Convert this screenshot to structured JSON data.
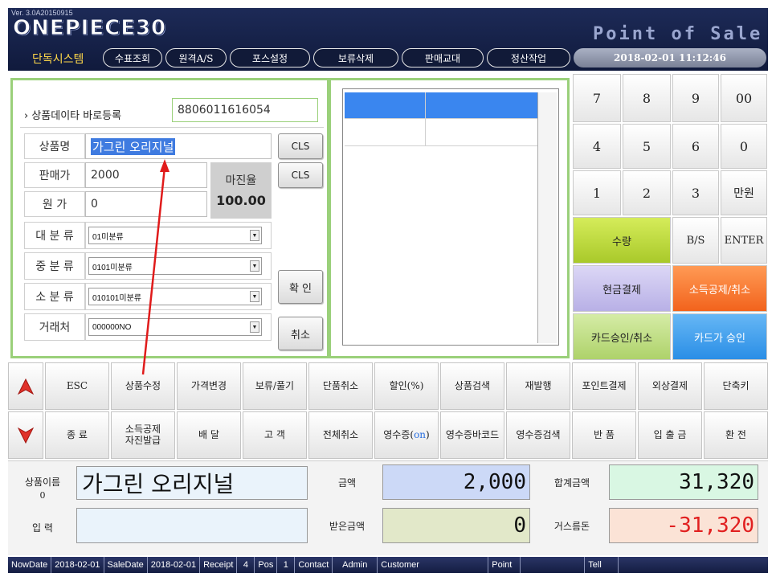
{
  "header": {
    "version": "Ver. 3.0A20150915",
    "logo": "ONEPIECE30",
    "brand": "Point of Sale",
    "system_label": "단독시스템",
    "nav": [
      "수표조회",
      "원격A/S",
      "포스설정",
      "보류삭제",
      "판매교대",
      "정산작업"
    ],
    "datetime": "2018-02-01 11:12:46"
  },
  "product_form": {
    "quick_register_label": "› 상품데이타 바로등록",
    "barcode": "8806011616054",
    "name_label": "상품명",
    "name_value": "가그린 오리지널",
    "price_label": "판매가",
    "price_value": "2000",
    "cost_label": "원 가",
    "cost_value": "0",
    "margin_label": "마진율",
    "margin_value": "100.00",
    "cls1": "CLS",
    "cls2": "CLS",
    "large_cat_label": "대 분 류",
    "large_cat_value": "01미분류",
    "mid_cat_label": "중 분 류",
    "mid_cat_value": "0101미분류",
    "small_cat_label": "소 분 류",
    "small_cat_value": "010101미분류",
    "vendor_label": "거래처",
    "vendor_value": "000000NO",
    "confirm": "확 인",
    "cancel": "취소"
  },
  "keypad": {
    "keys": [
      "7",
      "8",
      "9",
      "00",
      "4",
      "5",
      "6",
      "0",
      "1",
      "2",
      "3",
      "만원"
    ],
    "qty": "수량",
    "bs": "B/S",
    "enter": "ENTER",
    "cash_pay": "현금결제",
    "income_deduction": "소득공제/취소",
    "card_approve_cancel": "카드승인/취소",
    "card_approve": "카드가 승인"
  },
  "functions": {
    "row1": [
      "ESC",
      "상품수정",
      "가격변경",
      "보류/풀기",
      "단품취소",
      "할인(%)",
      "상품검색",
      "재발행",
      "포인트결제",
      "외상결제",
      "단축키"
    ],
    "row2": [
      "종 료",
      "소득공제 자진발급",
      "배 달",
      "고 객",
      "전체취소",
      "영수증(on)",
      "영수증바코드",
      "영수증검색",
      "반 품",
      "입 출 금",
      "환 전"
    ]
  },
  "summary": {
    "item_name_label": "상품이름",
    "item_count": "0",
    "item_name": "가그린 오리지널",
    "amount_label": "금액",
    "amount": "2,000",
    "total_label": "합계금액",
    "total": "31,320",
    "input_label": "입 력",
    "received_label": "받은금액",
    "received": "0",
    "change_label": "거스름돈",
    "change": "-31,320"
  },
  "statusbar": {
    "now_date_label": "NowDate",
    "now_date": "2018-02-01",
    "sale_date_label": "SaleDate",
    "sale_date": "2018-02-01",
    "receipt_label": "Receipt",
    "receipt": "4",
    "pos_label": "Pos",
    "pos": "1",
    "contact_label": "Contact",
    "contact": "Admin",
    "customer_label": "Customer",
    "point_label": "Point",
    "tell_label": "Tell"
  },
  "colors": {
    "header_bg": "#141d42",
    "panel_border": "#9ad07a",
    "qty_button": "#c7e23a",
    "cash_button": "#c9c3ef",
    "income_button": "#ff7a2e",
    "card_cancel_button": "#c3e08a",
    "card_approve_button": "#3ea0ef",
    "amount_bg": "#ccd9f7",
    "total_bg": "#d9f7e3",
    "received_bg": "#e2e8c9",
    "change_bg": "#fbe3d6",
    "change_text": "#e12020",
    "annotation_arrow": "#e01b1b"
  }
}
